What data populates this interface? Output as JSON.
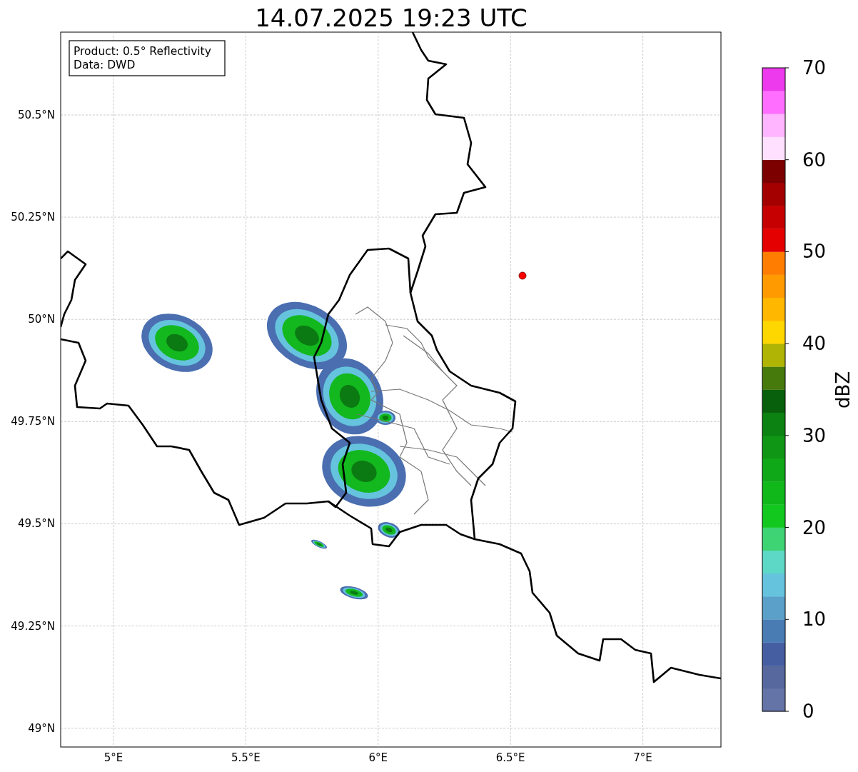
{
  "title": "14.07.2025 19:23 UTC",
  "map": {
    "legend": [
      "Product: 0.5° Reflectivity",
      "Data: DWD"
    ],
    "lat_ticks": [
      "50.5°N",
      "50.25°N",
      "50°N",
      "49.75°N",
      "49.5°N",
      "49.25°N",
      "49°N"
    ],
    "lon_ticks": [
      "5°E",
      "5.5°E",
      "6°E",
      "6.5°E",
      "7°E"
    ]
  },
  "colorbar": {
    "label": "dBZ",
    "ticks": [
      "70",
      "60",
      "50",
      "40",
      "30",
      "20",
      "10",
      "0"
    ],
    "bins": [
      {
        "color": "#6474a6"
      },
      {
        "color": "#56689e"
      },
      {
        "color": "#455ea2"
      },
      {
        "color": "#4a7cb4"
      },
      {
        "color": "#5aa0c8"
      },
      {
        "color": "#66c3de"
      },
      {
        "color": "#5ed8c6"
      },
      {
        "color": "#3ed474"
      },
      {
        "color": "#12c81e"
      },
      {
        "color": "#10b81a"
      },
      {
        "color": "#0fa818"
      },
      {
        "color": "#0e9614"
      },
      {
        "color": "#0b8212"
      },
      {
        "color": "#08600c"
      },
      {
        "color": "#467a0c"
      },
      {
        "color": "#b0b404"
      },
      {
        "color": "#ffd700"
      },
      {
        "color": "#ffb700"
      },
      {
        "color": "#ff9b00"
      },
      {
        "color": "#ff7d00"
      },
      {
        "color": "#e40000"
      },
      {
        "color": "#c60000"
      },
      {
        "color": "#a40000"
      },
      {
        "color": "#7c0000"
      },
      {
        "color": "#ffe0ff"
      },
      {
        "color": "#ffb5ff"
      },
      {
        "color": "#ff6eff"
      },
      {
        "color": "#ec3aec"
      }
    ]
  }
}
